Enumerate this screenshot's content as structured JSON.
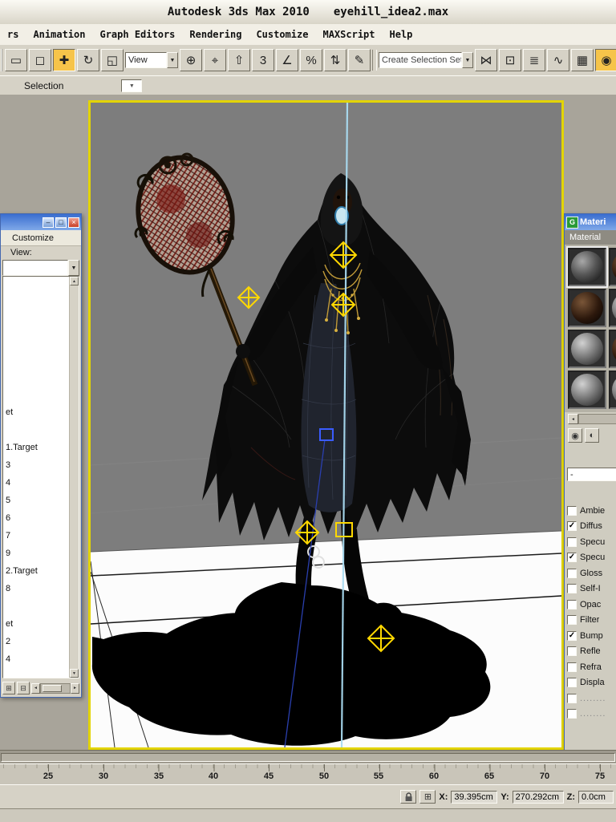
{
  "titlebar": {
    "app_title": "Autodesk 3ds Max  2010",
    "file_name": "eyehill_idea2.max"
  },
  "menubar": {
    "items": [
      "rs",
      "Animation",
      "Graph Editors",
      "Rendering",
      "Customize",
      "MAXScript",
      "Help"
    ]
  },
  "toolbar": {
    "view_combo_value": "View",
    "selection_set_placeholder": "Create Selection Set",
    "buttons": [
      {
        "glyph": "▭",
        "name": "selection-region"
      },
      {
        "glyph": "◻",
        "name": "select-object"
      },
      {
        "glyph": "✚",
        "name": "select-and-move"
      },
      {
        "glyph": "↻",
        "name": "select-and-rotate"
      },
      {
        "glyph": "◱",
        "name": "select-and-scale"
      },
      {
        "glyph": "⊕",
        "name": "use-center"
      },
      {
        "glyph": "⌖",
        "name": "select-and-manipulate"
      },
      {
        "glyph": "⇧",
        "name": "keyboard-override"
      },
      {
        "glyph": "3",
        "name": "snap-3d"
      },
      {
        "glyph": "∠",
        "name": "angle-snap"
      },
      {
        "glyph": "%",
        "name": "percent-snap"
      },
      {
        "glyph": "⇅",
        "name": "spinner-snap"
      },
      {
        "glyph": "✎",
        "name": "named-selection-sets"
      },
      {
        "glyph": "⋈",
        "name": "mirror"
      },
      {
        "glyph": "⊡",
        "name": "align"
      },
      {
        "glyph": "≣",
        "name": "layer-manager"
      },
      {
        "glyph": "∿",
        "name": "curve-editor"
      },
      {
        "glyph": "▦",
        "name": "schematic-view"
      },
      {
        "glyph": "◉",
        "name": "material-editor"
      }
    ]
  },
  "selection_row": {
    "label": "Selection"
  },
  "left_window": {
    "menu_item": "Customize",
    "view_label": "View:",
    "items": [
      "et",
      "",
      "1.Target",
      "3",
      "4",
      "5",
      "6",
      "7",
      "9",
      "2.Target",
      "8",
      "",
      "et",
      "2",
      "4"
    ]
  },
  "material_editor": {
    "title": "Materi",
    "menu_item": "Material",
    "combo_value": "-",
    "maps": [
      {
        "label": "Ambie",
        "check": ""
      },
      {
        "label": "Diffus",
        "check": "✓"
      },
      {
        "label": "Specu",
        "check": ""
      },
      {
        "label": "Specu",
        "check": "✓"
      },
      {
        "label": "Gloss",
        "check": ""
      },
      {
        "label": "Self-I",
        "check": ""
      },
      {
        "label": "Opac",
        "check": ""
      },
      {
        "label": "Filter",
        "check": ""
      },
      {
        "label": "Bump",
        "check": "✓"
      },
      {
        "label": "Refle",
        "check": ""
      },
      {
        "label": "Refra",
        "check": ""
      },
      {
        "label": "Displa",
        "check": ""
      },
      {
        "label": "........",
        "check": ""
      },
      {
        "label": "........",
        "check": ""
      }
    ]
  },
  "timeline": {
    "labels": [
      "25",
      "30",
      "35",
      "40",
      "45",
      "50",
      "55",
      "60",
      "65",
      "70",
      "75"
    ]
  },
  "statusbar": {
    "x_label": "X:",
    "x_value": "39.395cm",
    "y_label": "Y:",
    "y_value": "270.292cm",
    "z_label": "Z:",
    "z_value": "0.0cm"
  },
  "glyphs": {
    "dropdown": "▼",
    "left": "◄",
    "right": "►",
    "up": "▲",
    "down": "▼",
    "minimize": "–",
    "maximize": "□",
    "close": "×",
    "tool_pan": "⊞",
    "tool_zoom": "⊟",
    "sample_type": "◉",
    "backlight": "◐",
    "grid_mode": "⊞"
  },
  "colors": {
    "viewport_border": "#e3d400",
    "gizmo_yellow": "#ffd800",
    "selection_blue": "#3a5cff"
  }
}
